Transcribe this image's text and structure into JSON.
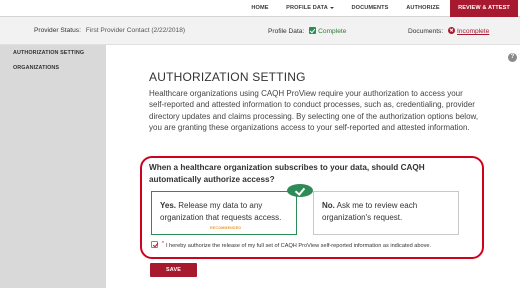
{
  "nav": {
    "home": "HOME",
    "profile_data": "PROFILE DATA",
    "documents": "DOCUMENTS",
    "authorize": "AUTHORIZE",
    "review_attest": "REVIEW & ATTEST"
  },
  "status": {
    "provider_label": "Provider Status:",
    "provider_value": "First Provider Contact (2/22/2018)",
    "profile_label": "Profile Data:",
    "profile_value": "Complete",
    "documents_label": "Documents:",
    "documents_value": "Incomplete"
  },
  "sidebar": {
    "items": [
      {
        "label": "AUTHORIZATION SETTING"
      },
      {
        "label": "ORGANIZATIONS"
      }
    ]
  },
  "help": {
    "glyph": "?"
  },
  "main": {
    "title": "AUTHORIZATION SETTING",
    "intro": "Healthcare organizations using CAQH ProView require your authorization to access your self-reported and attested information to conduct processes, such as, credentialing, provider directory updates and claims processing. By selecting one of the authorization options below, you are granting these organizations access to your self-reported and attested information.",
    "question": "When a healthcare organization subscribes to your data, should CAQH automatically authorize access?",
    "option_yes": {
      "lead": "Yes.",
      "text": " Release my data to any organization that requests access.",
      "badge": "RECOMMENDED",
      "selected": true
    },
    "option_no": {
      "lead": "No.",
      "text": " Ask me to review each organization's request.",
      "selected": false
    },
    "consent": {
      "checked": true,
      "text": "I hereby authorize the release of my full set of CAQH ProView self-reported information as indicated above."
    },
    "save_label": "SAVE"
  },
  "colors": {
    "brand": "#a6192e",
    "highlight": "#d0021b",
    "success": "#2e8b57",
    "sidebar": "#d9d9d9"
  }
}
